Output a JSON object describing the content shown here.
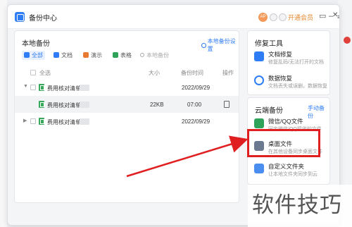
{
  "app": {
    "title": "备份中心",
    "avatar_text": "AP",
    "vip_label": "开通会员"
  },
  "titlebar_icons": [
    "skin-icon",
    "minimize-icon",
    "close-icon"
  ],
  "local_backup": {
    "title": "本地备份",
    "settings_label": "本地备份设置",
    "filters": [
      {
        "label": "全部",
        "color": "#2f7df6",
        "active": true
      },
      {
        "label": "文档",
        "color": "#2f7df6"
      },
      {
        "label": "演示",
        "color": "#e87b33"
      },
      {
        "label": "表格",
        "color": "#2fa35a"
      }
    ],
    "search_placeholder": "本地备份",
    "columns": {
      "select_all": "全选",
      "size": "大小",
      "time": "备份时间",
      "action": "操作"
    },
    "rows": [
      {
        "name": "费用核对清单",
        "size": "",
        "time": "2022/09/29",
        "expanded": true
      },
      {
        "name": "费用核对清单",
        "size": "22KB",
        "time": "07:00",
        "child": true
      },
      {
        "name": "费用核对清单",
        "size": "",
        "time": "2022/09/29",
        "expanded": false
      }
    ]
  },
  "repair_tools": {
    "title": "修复工具",
    "items": [
      {
        "name": "文档修复",
        "desc": "修复乱码/无法打开的文档",
        "color": "#2f7df6"
      },
      {
        "name": "数据恢复",
        "desc": "文档丢失或误删，数据恢复",
        "color": "#2f7df6"
      }
    ]
  },
  "cloud_backup": {
    "title": "云端备份",
    "manual_label": "手动备份",
    "items": [
      {
        "name": "微信/QQ文件",
        "desc": "同步微信/QQ接收的文件",
        "color": "#2fa35a"
      },
      {
        "name": "桌面文件",
        "desc": "在其他设备同步桌面文件",
        "color": "#6b7a8f"
      },
      {
        "name": "自定义文件夹",
        "desc": "让本地文件夹同步到云",
        "color": "#4a8ef0"
      }
    ]
  },
  "watermark": "软件技巧",
  "colors": {
    "accent": "#2f7df6",
    "annotation": "#e02020",
    "vip": "#e6862c"
  }
}
